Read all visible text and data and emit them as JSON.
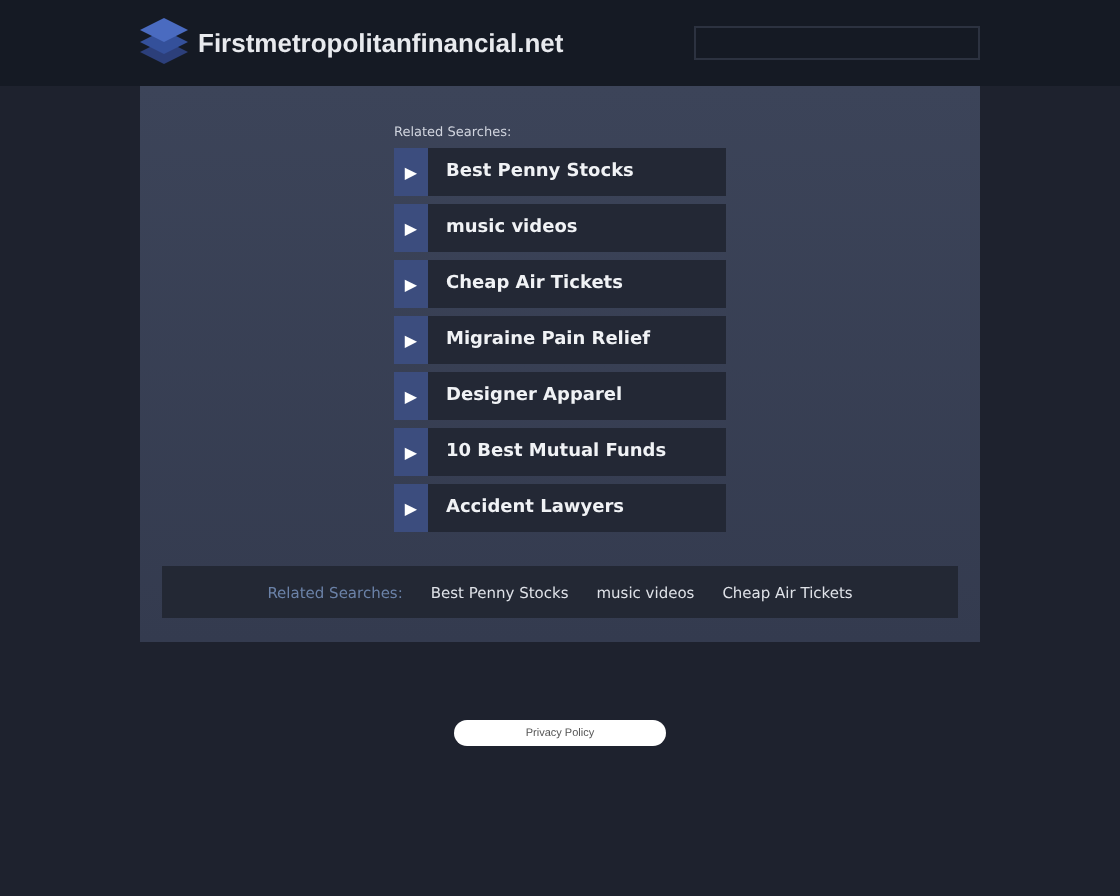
{
  "header": {
    "site_name": "Firstmetropolitanfinancial.net"
  },
  "related": {
    "heading": "Related Searches:",
    "links": [
      {
        "label": "Best Penny Stocks",
        "icon": "▶"
      },
      {
        "label": "music videos",
        "icon": "▶"
      },
      {
        "label": "Cheap Air Tickets",
        "icon": "▶"
      },
      {
        "label": "Migraine Pain Relief",
        "icon": "▶"
      },
      {
        "label": "Designer Apparel",
        "icon": "▶"
      },
      {
        "label": "10 Best Mutual Funds",
        "icon": "▶"
      },
      {
        "label": "Accident Lawyers",
        "icon": "▶"
      }
    ]
  },
  "footer_bar": {
    "heading": "Related Searches:",
    "links": [
      "Best Penny Stocks",
      "music videos",
      "Cheap Air Tickets"
    ]
  },
  "privacy_button": "Privacy Policy"
}
